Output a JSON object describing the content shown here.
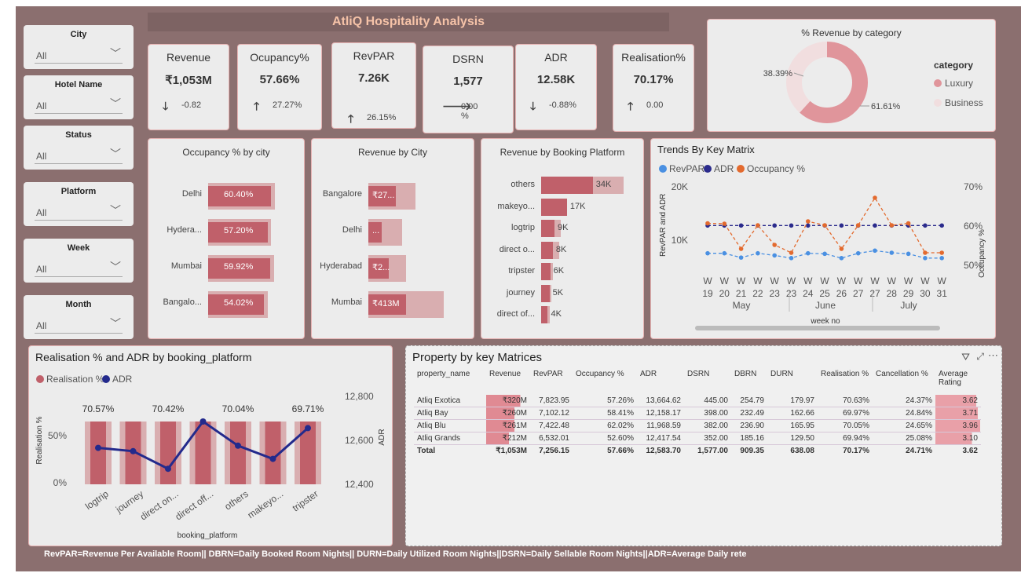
{
  "app": {
    "title": "AtliQ Hospitality Analysis"
  },
  "slicers": [
    {
      "label": "City",
      "value": "All"
    },
    {
      "label": "Hotel Name",
      "value": "All"
    },
    {
      "label": "Status",
      "value": "All"
    },
    {
      "label": "Platform",
      "value": "All"
    },
    {
      "label": "Week",
      "value": "All"
    },
    {
      "label": "Month",
      "value": "All"
    }
  ],
  "kpis": [
    {
      "title": "Revenue",
      "value": "₹1,053M",
      "delta": "-0.82",
      "trend": "down"
    },
    {
      "title": "Ocupancy%",
      "value": "57.66%",
      "delta": "27.27%",
      "trend": "up"
    },
    {
      "title": "RevPAR",
      "value": "7.26K",
      "delta": "26.15%",
      "trend": "up"
    },
    {
      "title": "DSRN",
      "value": "1,577",
      "delta": "0.00 %",
      "trend": "side"
    },
    {
      "title": "ADR",
      "value": "12.58K",
      "delta": "-0.88%",
      "trend": "down"
    },
    {
      "title": "Realisation%",
      "value": "70.17%",
      "delta": "0.00",
      "trend": "up"
    }
  ],
  "donut": {
    "title": "% Revenue by category",
    "legend_title": "category",
    "slices": [
      {
        "name": "Luxury",
        "percent": 61.61,
        "label": "61.61%",
        "color": "#e0959b"
      },
      {
        "name": "Business",
        "percent": 38.39,
        "label": "38.39%",
        "color": "#f1dedf"
      }
    ]
  },
  "occupancy_by_city": {
    "title": "Occupancy % by city",
    "rows": [
      {
        "city": "Delhi",
        "label": "60.40%",
        "value": 60.4
      },
      {
        "city": "Hydera...",
        "label": "57.20%",
        "value": 57.2
      },
      {
        "city": "Mumbai",
        "label": "59.92%",
        "value": 59.92
      },
      {
        "city": "Bangalo...",
        "label": "54.02%",
        "value": 54.02
      }
    ]
  },
  "revenue_by_city": {
    "title": "Revenue by City",
    "rows": [
      {
        "city": "Bangalore",
        "label": "₹27...",
        "value": 0.45,
        "bg": 0.62
      },
      {
        "city": "Delhi",
        "label": "...",
        "value": 0.22,
        "bg": 0.45
      },
      {
        "city": "Hyderabad",
        "label": "₹2...",
        "value": 0.33,
        "bg": 0.5
      },
      {
        "city": "Mumbai",
        "label": "₹413M",
        "value": 0.61,
        "bg": 1.0
      }
    ]
  },
  "revenue_by_platform": {
    "title": "Revenue by Booking Platform",
    "rows": [
      {
        "platform": "others",
        "label": "34K",
        "value": 0.62,
        "bg": 0.99
      },
      {
        "platform": "makeyo...",
        "label": "17K",
        "value": 0.31,
        "bg": 0.31
      },
      {
        "platform": "logtrip",
        "label": "9K",
        "value": 0.16,
        "bg": 0.24
      },
      {
        "platform": "direct o...",
        "label": "8K",
        "value": 0.14,
        "bg": 0.22
      },
      {
        "platform": "tripster",
        "label": "6K",
        "value": 0.11,
        "bg": 0.14
      },
      {
        "platform": "journey",
        "label": "5K",
        "value": 0.1,
        "bg": 0.12
      },
      {
        "platform": "direct of...",
        "label": "4K",
        "value": 0.08,
        "bg": 0.1
      }
    ]
  },
  "trends": {
    "title": "Trends By Key Matrix",
    "legend": [
      {
        "name": "RevPAR",
        "color": "#4a90e2"
      },
      {
        "name": "ADR",
        "color": "#2b2b8c"
      },
      {
        "name": "Occupancy %",
        "color": "#e36a2e"
      }
    ],
    "left_axis_label": "RevPAR and ADR",
    "right_axis_label": "Occupancy %",
    "left_ticks": [
      "20K",
      "10K"
    ],
    "right_ticks": [
      "70%",
      "60%",
      "50%"
    ],
    "weeks": [
      "19",
      "20",
      "21",
      "22",
      "23",
      "23",
      "24",
      "25",
      "26",
      "27",
      "27",
      "28",
      "29",
      "30",
      "31"
    ],
    "week_prefix": "W",
    "months": [
      "May",
      "June",
      "July"
    ],
    "xlabel": "week no"
  },
  "realisation": {
    "title": "Realisation % and ADR by booking_platform",
    "legend": [
      {
        "name": "Realisation %",
        "color": "#c0606a"
      },
      {
        "name": "ADR",
        "color": "#232a8c"
      }
    ],
    "ylabel_left": "Realisation %",
    "ylabel_right": "ADR",
    "left_ticks": [
      "50%",
      "0%"
    ],
    "right_ticks": [
      "12,800",
      "12,600",
      "12,400"
    ],
    "xlabel": "booking_platform",
    "categories": [
      "logtrip",
      "journey",
      "direct on...",
      "direct off...",
      "others",
      "makeyo...",
      "tripster"
    ],
    "bar_labels": [
      "70.57%",
      "",
      "70.42%",
      "",
      "70.04%",
      "",
      "69.71%"
    ]
  },
  "property_table": {
    "title": "Property by key Matrices",
    "headers": [
      "property_name",
      "Revenue",
      "RevPAR",
      "Occupancy %",
      "ADR",
      "DSRN",
      "DBRN",
      "DURN",
      "Realisation %",
      "Cancellation %",
      "Average Rating"
    ],
    "rows": [
      [
        "Atliq Exotica",
        "₹320M",
        "7,823.95",
        "57.26%",
        "13,664.62",
        "445.00",
        "254.79",
        "179.97",
        "70.63%",
        "24.37%",
        "3.62"
      ],
      [
        "Atliq Bay",
        "₹260M",
        "7,102.12",
        "58.41%",
        "12,158.17",
        "398.00",
        "232.49",
        "162.66",
        "69.97%",
        "24.84%",
        "3.71"
      ],
      [
        "Atliq Blu",
        "₹261M",
        "7,422.48",
        "62.02%",
        "11,968.59",
        "382.00",
        "236.90",
        "165.95",
        "70.05%",
        "24.65%",
        "3.96"
      ],
      [
        "Atliq Grands",
        "₹212M",
        "6,532.01",
        "52.60%",
        "12,417.54",
        "352.00",
        "185.16",
        "129.50",
        "69.94%",
        "25.08%",
        "3.10"
      ]
    ],
    "total": [
      "Total",
      "₹1,053M",
      "7,256.15",
      "57.66%",
      "12,583.70",
      "1,577.00",
      "909.35",
      "638.08",
      "70.17%",
      "24.71%",
      "3.62"
    ]
  },
  "footnote": "RevPAR=Revenue Per Available Room|| DBRN=Daily Booked Room Nights|| DURN=Daily Utilized Room Nights||DSRN=Daily Sellable Room Nights||ADR=Average Daily rete",
  "chart_data": [
    {
      "type": "pie",
      "title": "% Revenue by category",
      "categories": [
        "Luxury",
        "Business"
      ],
      "values": [
        61.61,
        38.39
      ]
    },
    {
      "type": "bar",
      "title": "Occupancy % by city",
      "categories": [
        "Delhi",
        "Hydera...",
        "Mumbai",
        "Bangalo..."
      ],
      "values": [
        60.4,
        57.2,
        59.92,
        54.02
      ]
    },
    {
      "type": "bar",
      "title": "Revenue by Booking Platform",
      "categories": [
        "others",
        "makeyo...",
        "logtrip",
        "direct o...",
        "tripster",
        "journey",
        "direct of..."
      ],
      "values": [
        34000,
        17000,
        9000,
        8000,
        6000,
        5000,
        4000
      ]
    },
    {
      "type": "line",
      "title": "Trends By Key Matrix",
      "x": [
        "W 19",
        "W 20",
        "W 21",
        "W 22",
        "W 23",
        "W 23",
        "W 24",
        "W 25",
        "W 26",
        "W 27",
        "W 27",
        "W 28",
        "W 29",
        "W 30",
        "W 31"
      ],
      "series": [
        {
          "name": "RevPAR",
          "values": [
            7400,
            7400,
            6600,
            7400,
            7000,
            6500,
            7400,
            7300,
            6500,
            7400,
            7900,
            7500,
            7300,
            6500,
            6500
          ]
        },
        {
          "name": "ADR",
          "values": [
            12600,
            12600,
            12600,
            12600,
            12600,
            12600,
            12600,
            12600,
            12600,
            12600,
            12600,
            12600,
            12600,
            12600,
            12600
          ]
        },
        {
          "name": "Occupancy %",
          "values": [
            60.5,
            60.4,
            54,
            60,
            55,
            53,
            61,
            60,
            54,
            60,
            67,
            60,
            60.5,
            53,
            53
          ]
        }
      ],
      "ylim_left": [
        0,
        20000
      ],
      "ylim_right": [
        50,
        70
      ]
    },
    {
      "type": "bar",
      "title": "Realisation % and ADR by booking_platform",
      "categories": [
        "logtrip",
        "journey",
        "direct on...",
        "direct off...",
        "others",
        "makeyo...",
        "tripster"
      ],
      "series": [
        {
          "name": "Realisation %",
          "values": [
            70.57,
            70.3,
            70.42,
            70.1,
            70.04,
            69.9,
            69.71
          ]
        },
        {
          "name": "ADR",
          "values": [
            12580,
            12565,
            12485,
            12700,
            12590,
            12530,
            12670
          ]
        }
      ],
      "ylim_right": [
        12400,
        12800
      ]
    }
  ]
}
